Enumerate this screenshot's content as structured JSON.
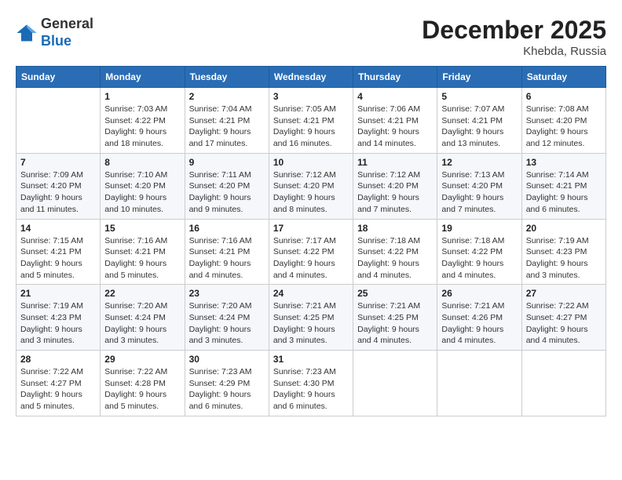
{
  "logo": {
    "general": "General",
    "blue": "Blue"
  },
  "title": {
    "month_year": "December 2025",
    "location": "Khebda, Russia"
  },
  "weekdays": [
    "Sunday",
    "Monday",
    "Tuesday",
    "Wednesday",
    "Thursday",
    "Friday",
    "Saturday"
  ],
  "weeks": [
    [
      {
        "day": "",
        "info": ""
      },
      {
        "day": "1",
        "info": "Sunrise: 7:03 AM\nSunset: 4:22 PM\nDaylight: 9 hours\nand 18 minutes."
      },
      {
        "day": "2",
        "info": "Sunrise: 7:04 AM\nSunset: 4:21 PM\nDaylight: 9 hours\nand 17 minutes."
      },
      {
        "day": "3",
        "info": "Sunrise: 7:05 AM\nSunset: 4:21 PM\nDaylight: 9 hours\nand 16 minutes."
      },
      {
        "day": "4",
        "info": "Sunrise: 7:06 AM\nSunset: 4:21 PM\nDaylight: 9 hours\nand 14 minutes."
      },
      {
        "day": "5",
        "info": "Sunrise: 7:07 AM\nSunset: 4:21 PM\nDaylight: 9 hours\nand 13 minutes."
      },
      {
        "day": "6",
        "info": "Sunrise: 7:08 AM\nSunset: 4:20 PM\nDaylight: 9 hours\nand 12 minutes."
      }
    ],
    [
      {
        "day": "7",
        "info": "Sunrise: 7:09 AM\nSunset: 4:20 PM\nDaylight: 9 hours\nand 11 minutes."
      },
      {
        "day": "8",
        "info": "Sunrise: 7:10 AM\nSunset: 4:20 PM\nDaylight: 9 hours\nand 10 minutes."
      },
      {
        "day": "9",
        "info": "Sunrise: 7:11 AM\nSunset: 4:20 PM\nDaylight: 9 hours\nand 9 minutes."
      },
      {
        "day": "10",
        "info": "Sunrise: 7:12 AM\nSunset: 4:20 PM\nDaylight: 9 hours\nand 8 minutes."
      },
      {
        "day": "11",
        "info": "Sunrise: 7:12 AM\nSunset: 4:20 PM\nDaylight: 9 hours\nand 7 minutes."
      },
      {
        "day": "12",
        "info": "Sunrise: 7:13 AM\nSunset: 4:20 PM\nDaylight: 9 hours\nand 7 minutes."
      },
      {
        "day": "13",
        "info": "Sunrise: 7:14 AM\nSunset: 4:21 PM\nDaylight: 9 hours\nand 6 minutes."
      }
    ],
    [
      {
        "day": "14",
        "info": "Sunrise: 7:15 AM\nSunset: 4:21 PM\nDaylight: 9 hours\nand 5 minutes."
      },
      {
        "day": "15",
        "info": "Sunrise: 7:16 AM\nSunset: 4:21 PM\nDaylight: 9 hours\nand 5 minutes."
      },
      {
        "day": "16",
        "info": "Sunrise: 7:16 AM\nSunset: 4:21 PM\nDaylight: 9 hours\nand 4 minutes."
      },
      {
        "day": "17",
        "info": "Sunrise: 7:17 AM\nSunset: 4:22 PM\nDaylight: 9 hours\nand 4 minutes."
      },
      {
        "day": "18",
        "info": "Sunrise: 7:18 AM\nSunset: 4:22 PM\nDaylight: 9 hours\nand 4 minutes."
      },
      {
        "day": "19",
        "info": "Sunrise: 7:18 AM\nSunset: 4:22 PM\nDaylight: 9 hours\nand 4 minutes."
      },
      {
        "day": "20",
        "info": "Sunrise: 7:19 AM\nSunset: 4:23 PM\nDaylight: 9 hours\nand 3 minutes."
      }
    ],
    [
      {
        "day": "21",
        "info": "Sunrise: 7:19 AM\nSunset: 4:23 PM\nDaylight: 9 hours\nand 3 minutes."
      },
      {
        "day": "22",
        "info": "Sunrise: 7:20 AM\nSunset: 4:24 PM\nDaylight: 9 hours\nand 3 minutes."
      },
      {
        "day": "23",
        "info": "Sunrise: 7:20 AM\nSunset: 4:24 PM\nDaylight: 9 hours\nand 3 minutes."
      },
      {
        "day": "24",
        "info": "Sunrise: 7:21 AM\nSunset: 4:25 PM\nDaylight: 9 hours\nand 3 minutes."
      },
      {
        "day": "25",
        "info": "Sunrise: 7:21 AM\nSunset: 4:25 PM\nDaylight: 9 hours\nand 4 minutes."
      },
      {
        "day": "26",
        "info": "Sunrise: 7:21 AM\nSunset: 4:26 PM\nDaylight: 9 hours\nand 4 minutes."
      },
      {
        "day": "27",
        "info": "Sunrise: 7:22 AM\nSunset: 4:27 PM\nDaylight: 9 hours\nand 4 minutes."
      }
    ],
    [
      {
        "day": "28",
        "info": "Sunrise: 7:22 AM\nSunset: 4:27 PM\nDaylight: 9 hours\nand 5 minutes."
      },
      {
        "day": "29",
        "info": "Sunrise: 7:22 AM\nSunset: 4:28 PM\nDaylight: 9 hours\nand 5 minutes."
      },
      {
        "day": "30",
        "info": "Sunrise: 7:23 AM\nSunset: 4:29 PM\nDaylight: 9 hours\nand 6 minutes."
      },
      {
        "day": "31",
        "info": "Sunrise: 7:23 AM\nSunset: 4:30 PM\nDaylight: 9 hours\nand 6 minutes."
      },
      {
        "day": "",
        "info": ""
      },
      {
        "day": "",
        "info": ""
      },
      {
        "day": "",
        "info": ""
      }
    ]
  ]
}
